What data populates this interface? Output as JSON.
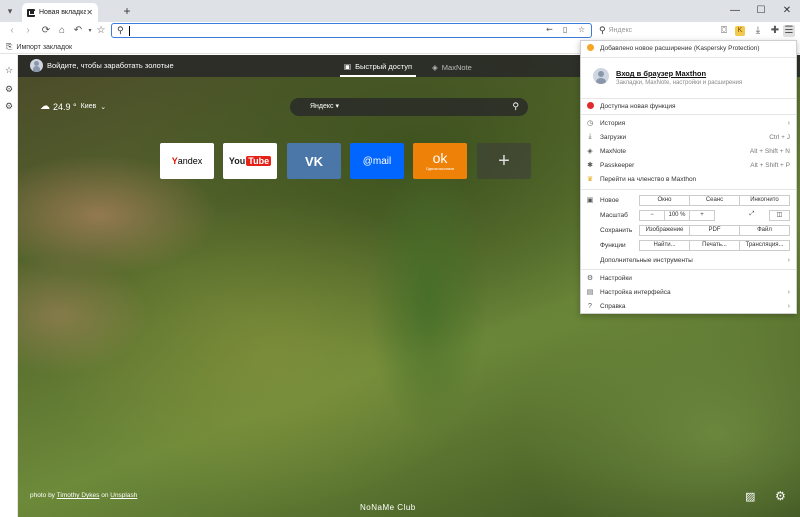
{
  "browser": {
    "tab_title": "Новая вкладка",
    "tab_close": "✕",
    "new_tab": "+",
    "tab_menu": "▾",
    "window": {
      "minimize": "—",
      "maximize": "☐",
      "close": "✕"
    },
    "address_value": "",
    "search_placeholder": "Яндекс",
    "bookmarks": {
      "import_label": "Импорт закладок"
    }
  },
  "content": {
    "signin_text": "Войдите, чтобы заработать золотые",
    "tabs": {
      "quick": "Быстрый доступ",
      "note": "MaxNote"
    },
    "weather": {
      "temp": "24.9 °",
      "city": "Киев",
      "chevron": "⌄"
    },
    "search_engine": "Яндекс ▾",
    "speed_dial": {
      "yandex": {
        "y": "Y",
        "rest": "andex"
      },
      "youtube": {
        "you": "You",
        "tube": "Tube"
      },
      "vk": "VK",
      "mail": "@mail",
      "ok": {
        "symbol": "ok",
        "sub": "Одноклассники"
      },
      "add": "+"
    },
    "credit": {
      "prefix": "photo by",
      "author": "Timothy Dykes",
      "on": "on",
      "source": "Unsplash"
    },
    "watermark": "NoNaMe Club"
  },
  "menu": {
    "notice": "Добавлено новое расширение (Kaspersky Protection)",
    "login_title": "Вход в браузер Maxthon",
    "login_sub": "Закладки, MaxNote, настройки и расширения",
    "new_feature": "Доступна новая функция",
    "items": [
      {
        "label": "История",
        "shortcut": "",
        "arrow": "›"
      },
      {
        "label": "Загрузки",
        "shortcut": "Ctrl + J",
        "arrow": ""
      },
      {
        "label": "MaxNote",
        "shortcut": "Alt + Shift + N",
        "arrow": ""
      },
      {
        "label": "Passkeeper",
        "shortcut": "Alt + Shift + P",
        "arrow": ""
      },
      {
        "label": "Перейти на членство в Maxthon",
        "shortcut": "",
        "arrow": ""
      }
    ],
    "grid": {
      "new_label": "Новое",
      "window": "Окно",
      "session": "Сеанс",
      "incognito": "Инкогнито",
      "zoom_label": "Масштаб",
      "zoom_minus": "−",
      "zoom_value": "100 %",
      "zoom_plus": "+",
      "save_label": "Сохранить",
      "image": "Изображение",
      "pdf": "PDF",
      "file": "Файл",
      "functions_label": "Функции",
      "find": "Найти...",
      "print": "Печать...",
      "cast": "Трансляция..."
    },
    "more_tools": "Дополнительные инструменты",
    "settings": "Настройки",
    "interface": "Настройка интерфейса",
    "help": "Справка"
  }
}
